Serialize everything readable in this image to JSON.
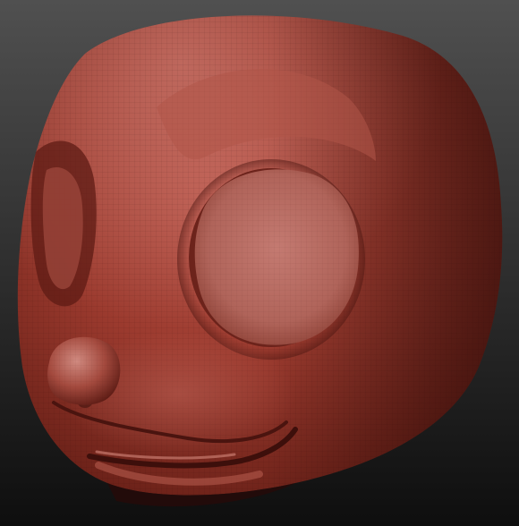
{
  "scene": {
    "subject": "sculpted-character-head",
    "material_color": "#9a3a2f",
    "material_highlight": "#c97a70",
    "material_shadow": "#4a1712",
    "background_top": "#505050",
    "background_bottom": "#101010"
  }
}
